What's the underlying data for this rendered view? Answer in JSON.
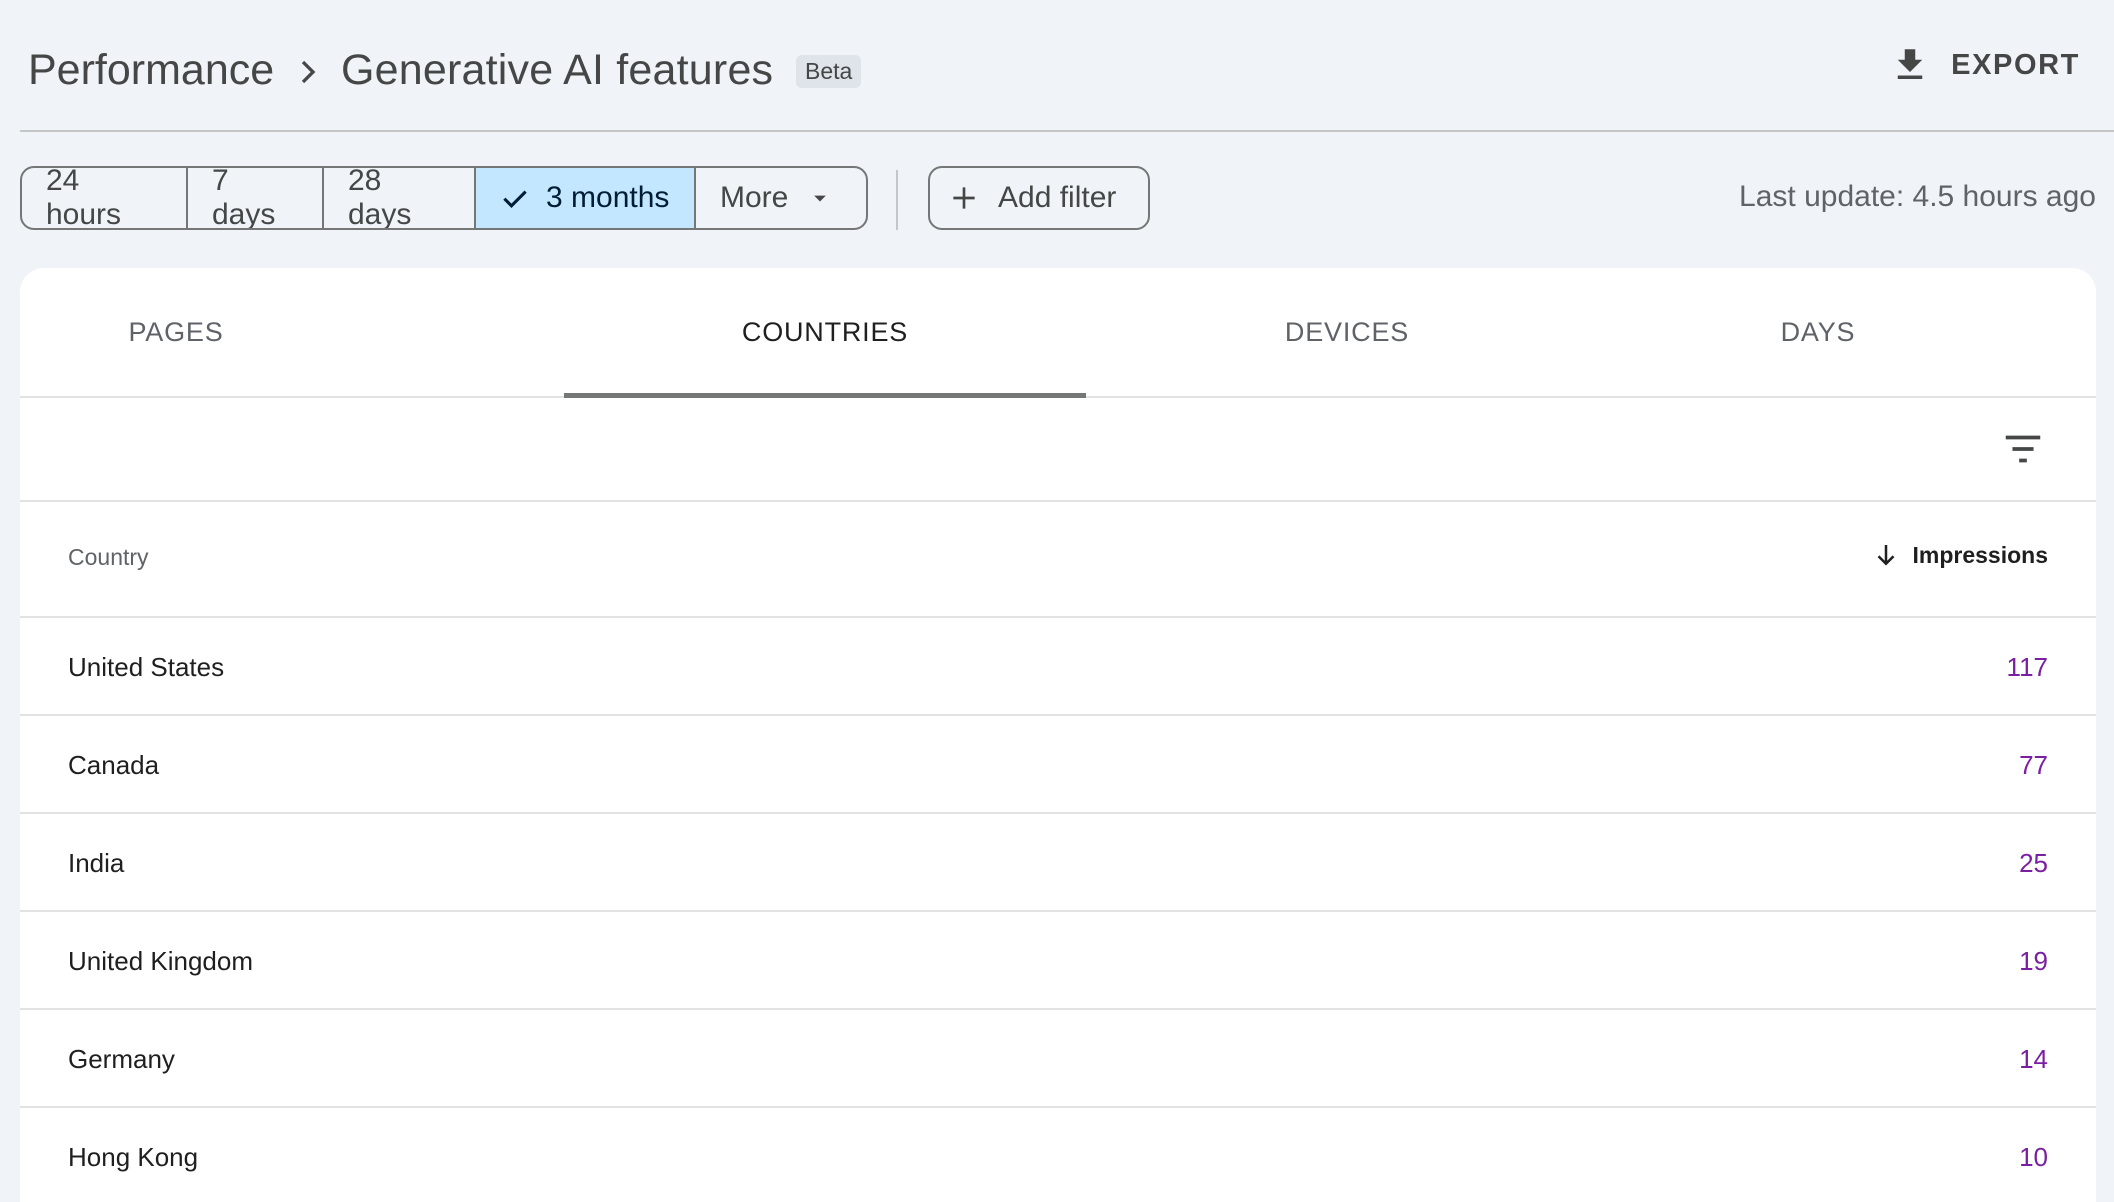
{
  "header": {
    "breadcrumb_root": "Performance",
    "title": "Generative AI features",
    "badge": "Beta",
    "export_label": "EXPORT"
  },
  "date_range": {
    "options": [
      "24 hours",
      "7 days",
      "28 days",
      "3 months"
    ],
    "selected": "3 months",
    "more_label": "More"
  },
  "add_filter_label": "Add filter",
  "last_update": "Last update: 4.5 hours ago",
  "tabs": [
    {
      "label": "PAGES"
    },
    {
      "label": "COUNTRIES"
    },
    {
      "label": "DEVICES"
    },
    {
      "label": "DAYS"
    }
  ],
  "active_tab": "COUNTRIES",
  "table": {
    "columns": {
      "country": "Country",
      "impressions": "Impressions"
    },
    "sort": "impressions-descending",
    "rows": [
      {
        "country": "United States",
        "impressions": "117"
      },
      {
        "country": "Canada",
        "impressions": "77"
      },
      {
        "country": "India",
        "impressions": "25"
      },
      {
        "country": "United Kingdom",
        "impressions": "19"
      },
      {
        "country": "Germany",
        "impressions": "14"
      },
      {
        "country": "Hong Kong",
        "impressions": "10"
      }
    ]
  },
  "colors": {
    "selected_chip": "#c2e7ff",
    "impressions_value": "#7b1fa2",
    "background": "#f0f4f9"
  },
  "icons": [
    "chevron-right-icon",
    "download-icon",
    "check-icon",
    "dropdown-arrow-icon",
    "plus-icon",
    "filter-list-icon",
    "arrow-down-icon"
  ]
}
